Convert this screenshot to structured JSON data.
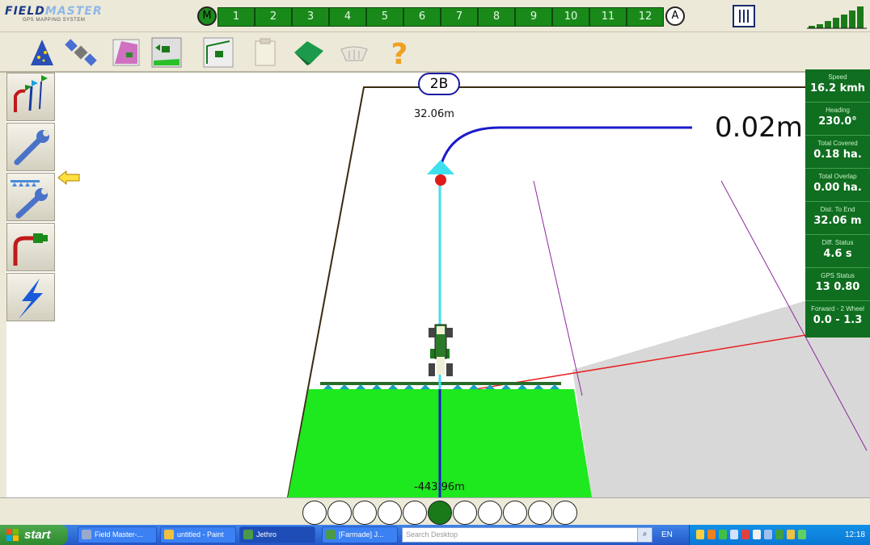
{
  "app": {
    "logo_brand_part1": "FIELD",
    "logo_brand_part2": "MASTER",
    "logo_subtitle": "GPS MAPPING SYSTEM"
  },
  "topbar": {
    "master_button": "M",
    "auto_button": "A",
    "sections": [
      "1",
      "2",
      "3",
      "4",
      "5",
      "6",
      "7",
      "8",
      "9",
      "10",
      "11",
      "12"
    ]
  },
  "toolbar": {
    "icons": [
      "wizard-icon",
      "satellite-icon",
      "field-map-icon",
      "field-tractor-icon",
      "field-guidance-icon",
      "clipboard-icon",
      "terrain-icon",
      "boom-icon",
      "help-icon"
    ]
  },
  "sidemenu": {
    "icons": [
      "flags-icon",
      "wrench-icon",
      "boom-settings-icon",
      "steering-icon",
      "lightning-icon"
    ]
  },
  "map": {
    "lane_label": "2B",
    "distance_ahead": "32.06m",
    "cross_track_error": "0.02m",
    "distance_behind": "-443.96m"
  },
  "stats": [
    {
      "label": "Speed",
      "value": "16.2 kmh"
    },
    {
      "label": "Heading",
      "value": "230.0°"
    },
    {
      "label": "Total Covered",
      "value": "0.18 ha."
    },
    {
      "label": "Total Overlap",
      "value": "0.00 ha."
    },
    {
      "label": "Dist. To End",
      "value": "32.06 m"
    },
    {
      "label": "Diff. Status",
      "value": "4.6 s"
    },
    {
      "label": "GPS Status",
      "value": "13   0.80"
    },
    {
      "label": "Forward - 2 Wheel",
      "value": "0.0 - 1.3"
    }
  ],
  "section_indicators": {
    "count": 11,
    "active_index": 5
  },
  "taskbar": {
    "start": "start",
    "tasks": [
      "Field Master-...",
      "untitled - Paint",
      "Jethro",
      "[Farmade] J..."
    ],
    "search_placeholder": "Search Desktop",
    "language": "EN",
    "clock": "12:18"
  },
  "colors": {
    "section_green": "#198a19",
    "panel_green": "#0f6e1f",
    "coverage_green": "#1ee81e",
    "guidance_cyan": "#3ee0ee",
    "guidance_blue": "#1a1acc"
  }
}
